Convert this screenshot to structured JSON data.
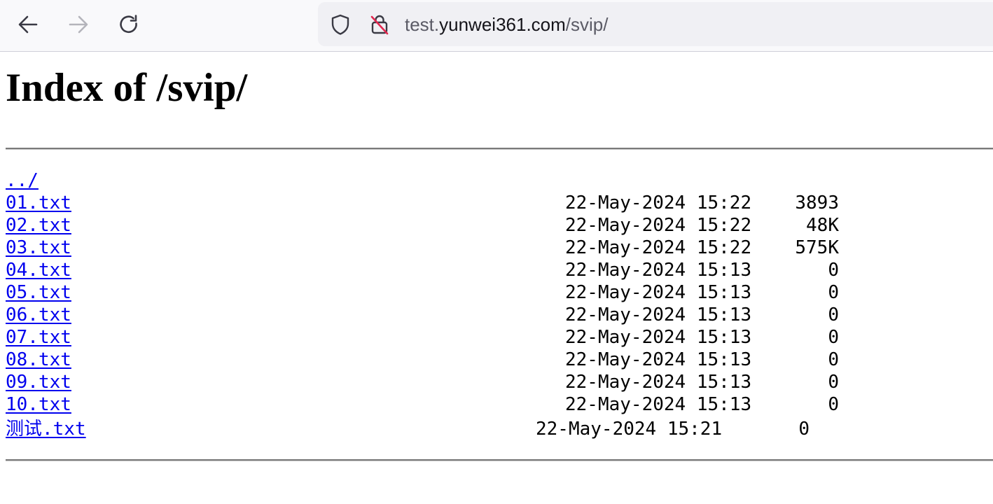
{
  "browser": {
    "url_scheme_part": "test.",
    "url_host": "yunwei361.com",
    "url_path": "/svip/"
  },
  "page": {
    "title": "Index of /svip/"
  },
  "listing": {
    "parent_link": "../",
    "entries": [
      {
        "name": "01.txt",
        "date": "22-May-2024 15:22",
        "size": "3893"
      },
      {
        "name": "02.txt",
        "date": "22-May-2024 15:22",
        "size": "48K"
      },
      {
        "name": "03.txt",
        "date": "22-May-2024 15:22",
        "size": "575K"
      },
      {
        "name": "04.txt",
        "date": "22-May-2024 15:13",
        "size": "0"
      },
      {
        "name": "05.txt",
        "date": "22-May-2024 15:13",
        "size": "0"
      },
      {
        "name": "06.txt",
        "date": "22-May-2024 15:13",
        "size": "0"
      },
      {
        "name": "07.txt",
        "date": "22-May-2024 15:13",
        "size": "0"
      },
      {
        "name": "08.txt",
        "date": "22-May-2024 15:13",
        "size": "0"
      },
      {
        "name": "09.txt",
        "date": "22-May-2024 15:13",
        "size": "0"
      },
      {
        "name": "10.txt",
        "date": "22-May-2024 15:13",
        "size": "0"
      },
      {
        "name": "测试.txt",
        "date": "22-May-2024 15:21",
        "size": "0"
      }
    ]
  },
  "colors": {
    "link": "#0000ee",
    "toolbar_bg": "#f9f9fb",
    "urlbar_bg": "#f0f0f4",
    "insecure_strike": "#e22850"
  },
  "icons": {
    "back": "arrow-left-icon",
    "forward": "arrow-right-icon",
    "reload": "reload-icon",
    "tracking_protection": "shield-icon",
    "connection": "insecure-lock-icon"
  }
}
